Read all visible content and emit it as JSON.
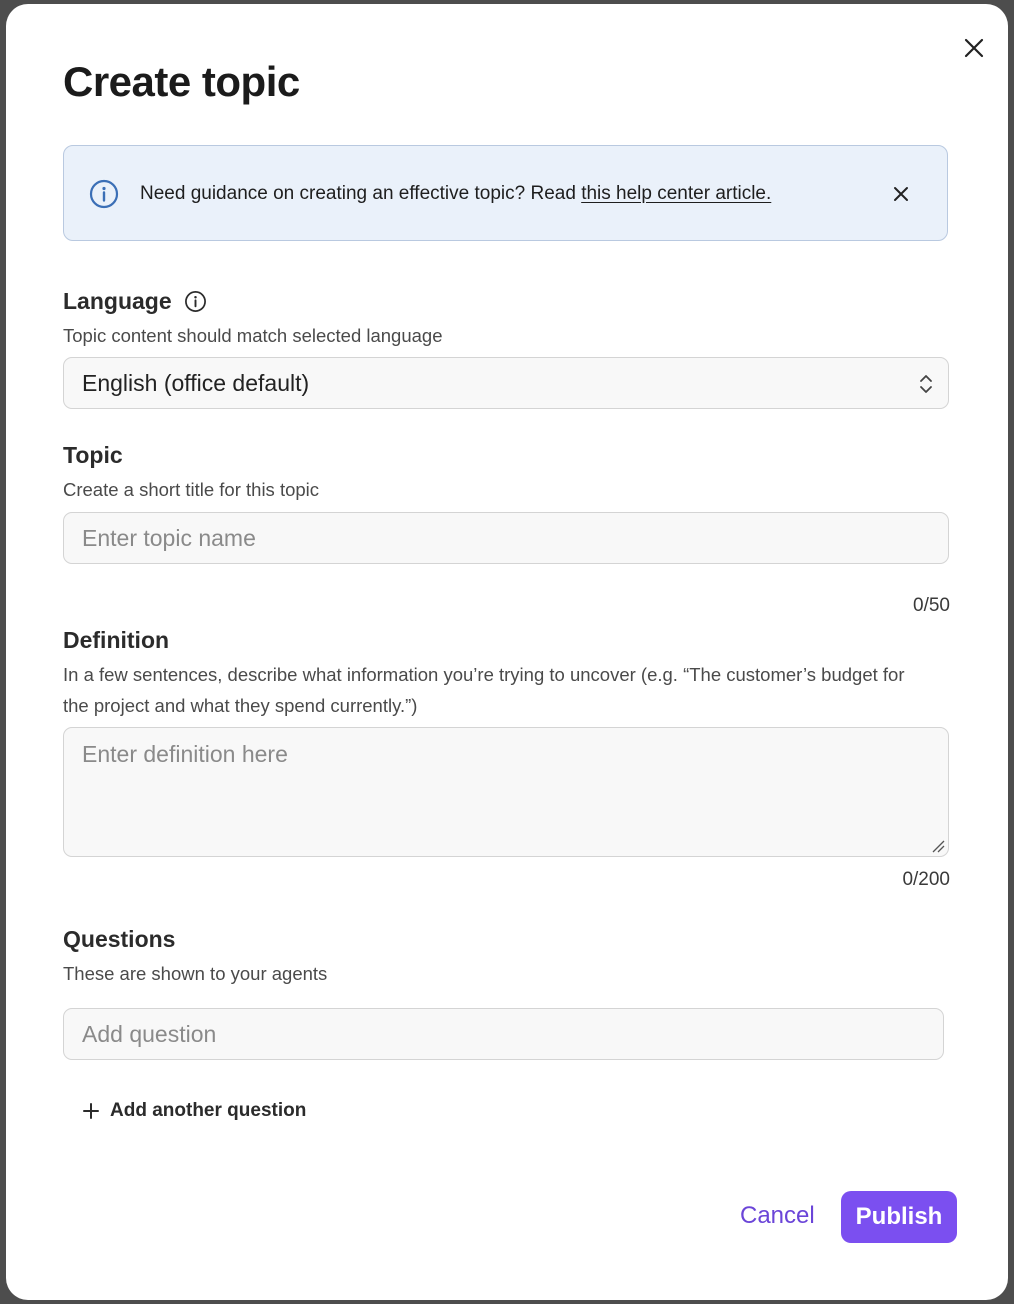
{
  "dialog": {
    "title": "Create topic",
    "close_icon": "close-icon"
  },
  "banner": {
    "icon": "info-icon",
    "text": "Need guidance on creating an effective topic? Read ",
    "link_text": "this help center article.",
    "close_icon": "close-icon"
  },
  "language": {
    "label": "Language",
    "info_icon": "info-icon",
    "hint": "Topic content should match selected language",
    "selected": "English (office default)",
    "chevron_icon": "up-down-chevron-icon"
  },
  "topic": {
    "label": "Topic",
    "hint": "Create a short title for this topic",
    "value": "",
    "placeholder": "Enter topic name",
    "counter": "0/50"
  },
  "definition": {
    "label": "Definition",
    "hint": "In a few sentences, describe what information you’re trying to uncover (e.g. “The customer’s budget for the project and what they spend currently.”)",
    "value": "",
    "placeholder": "Enter definition here",
    "counter": "0/200"
  },
  "questions": {
    "label": "Questions",
    "hint": "These are shown to your agents",
    "placeholder": "Add question",
    "add_label": "Add another question",
    "add_icon": "plus-icon"
  },
  "footer": {
    "cancel_label": "Cancel",
    "publish_label": "Publish"
  },
  "colors": {
    "accent": "#7b4ff0",
    "cancel_text": "#6b45d8",
    "banner_bg": "#eaf1fa",
    "banner_icon": "#3b6fb6"
  }
}
